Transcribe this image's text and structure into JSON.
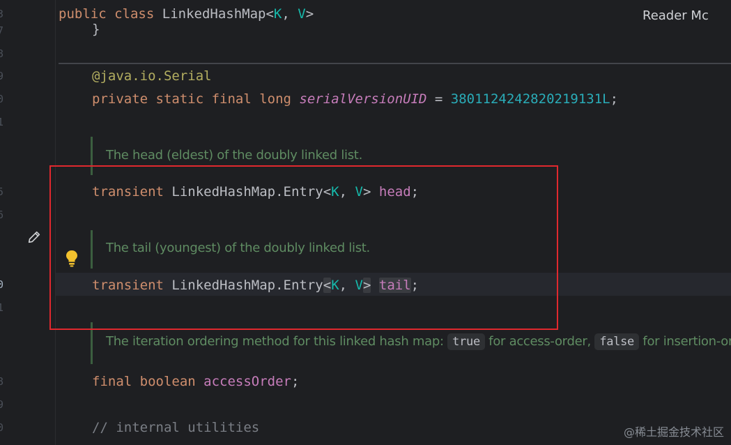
{
  "gutter": {
    "line_numbers": [
      "3",
      "7",
      "8",
      "9",
      "0",
      "1",
      "5",
      "6",
      "0",
      "1",
      "8",
      "9",
      "0"
    ]
  },
  "code": {
    "class_decl": {
      "kw1": "public",
      "kw2": "class",
      "name": "LinkedHashMap<",
      "K": "K",
      ",": ", ",
      "V": "V",
      ">": ">"
    },
    "closing_brace": "}",
    "annotation": {
      "at": "@java.io.",
      "name": "Serial"
    },
    "serial_line": {
      "kw": "private static final long",
      "field": "serialVersionUID",
      "eq": " = ",
      "num": "3801124242820219131L",
      "semi": ";"
    },
    "head_doc": "The head (eldest) of the doubly linked list.",
    "head_line": {
      "kw": "transient",
      "type": " LinkedHashMap.Entry<",
      "K": "K",
      "sep": ", ",
      "V": "V",
      "gt": ">",
      "field": "head",
      "semi": ";"
    },
    "tail_doc": "The tail (youngest) of the doubly linked list.",
    "tail_line": {
      "kw": "transient",
      "type": " LinkedHashMap.Entry",
      "lt": "<",
      "K": "K",
      "sep": ", ",
      "V": "V",
      "gt": ">",
      "field": "tail",
      "semi": ";"
    },
    "order_doc": {
      "pre": "The iteration ordering method for this linked hash map: ",
      "c1": "true",
      "mid": " for access-order, ",
      "c2": "false",
      "post": " for insertion-ord"
    },
    "access_line": {
      "kw": "final boolean",
      "field": "accessOrder",
      "semi": ";"
    },
    "comment": "// internal utilities"
  },
  "reader_mode": "Reader Mc",
  "watermark": "@稀土掘金技术社区"
}
